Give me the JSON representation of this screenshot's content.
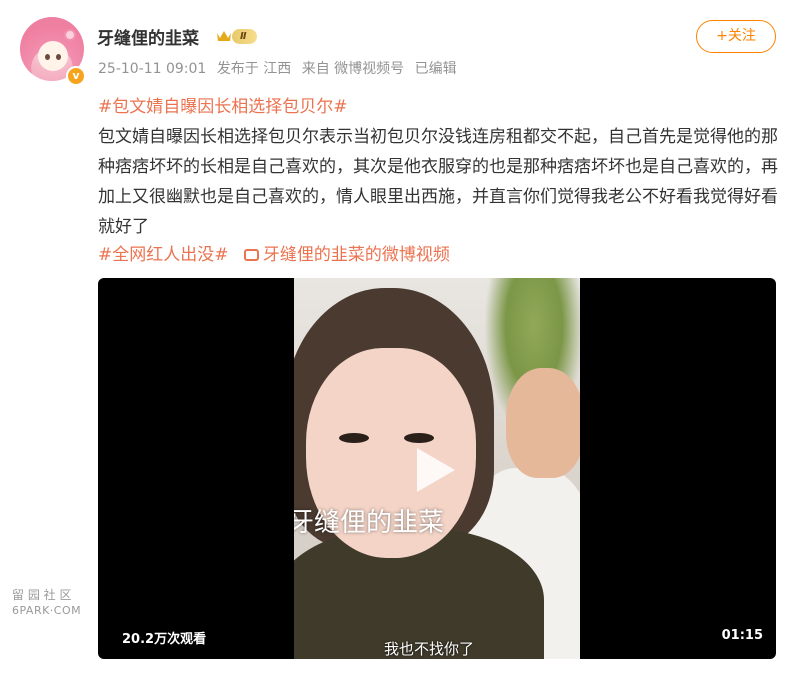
{
  "author": {
    "name": "牙缝俚的韭菜",
    "level_badge": "Ⅱ",
    "verified_mark": "v"
  },
  "post": {
    "date": "25-10-11 09:01",
    "location": "发布于 江西",
    "source": "来自 微博视频号",
    "edited": "已编辑",
    "topic": "#包文婧自曝因长相选择包贝尔#",
    "text": "包文婧自曝因长相选择包贝尔表示当初包贝尔没钱连房租都交不起，自己首先是觉得他的那种痞痞坏坏的长相是自己喜欢的，其次是他衣服穿的也是那种痞痞坏坏也是自己喜欢的，再加上又很幽默也是自己喜欢的，情人眼里出西施，并直言你们觉得我老公不好看我觉得好看就好了",
    "tag1": "#全网红人出没#",
    "video_link": "牙缝俚的韭菜的微博视频"
  },
  "actions": {
    "follow": "+关注"
  },
  "video": {
    "watermark": "牙缝俚的韭菜",
    "subtitle": "我也不找你了",
    "views": "20.2万次观看",
    "duration": "01:15"
  },
  "site_watermark": {
    "line1": "留 园 社 区",
    "line2": "6PARK·COM"
  },
  "colors": {
    "accent": "#ff8200",
    "link": "#eb7350",
    "meta": "#939393"
  },
  "icons": [
    "crown-icon",
    "video-link-icon",
    "play-icon",
    "verified-icon"
  ]
}
